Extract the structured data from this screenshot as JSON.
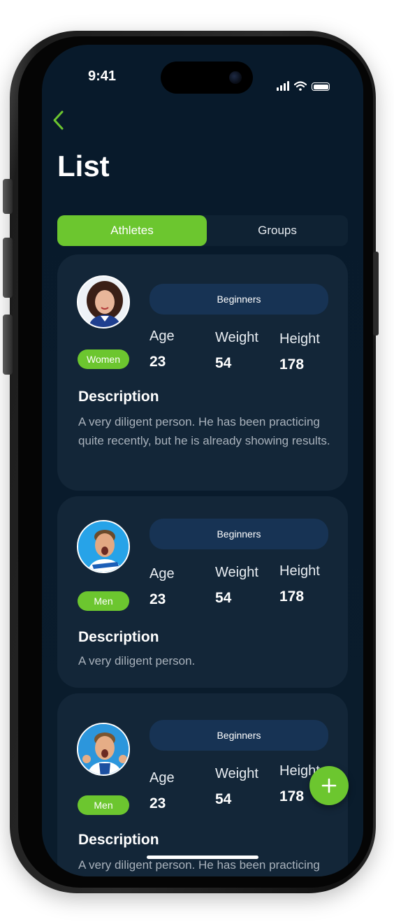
{
  "status_bar": {
    "time": "9:41"
  },
  "header": {
    "back_icon": "chevron-left-icon",
    "title": "List"
  },
  "tabs": [
    {
      "label": "Athletes",
      "selected": true
    },
    {
      "label": "Groups",
      "selected": false
    }
  ],
  "athletes": [
    {
      "group": "Beginners",
      "gender": "Women",
      "age_label": "Age",
      "age": "23",
      "weight_label": "Weight",
      "weight": "54",
      "height_label": "Height",
      "height": "178",
      "description_heading": "Description",
      "description": "A very diligent person. He has been practicing quite recently, but he is already showing results."
    },
    {
      "group": "Beginners",
      "gender": "Men",
      "age_label": "Age",
      "age": "23",
      "weight_label": "Weight",
      "weight": "54",
      "height_label": "Height",
      "height": "178",
      "description_heading": "Description",
      "description": "A very diligent person."
    },
    {
      "group": "Beginners",
      "gender": "Men",
      "age_label": "Age",
      "age": "23",
      "weight_label": "Weight",
      "weight": "54",
      "height_label": "Height",
      "height": "178",
      "description_heading": "Description",
      "description": "A very diligent person. He has been practicing"
    }
  ],
  "fab": {
    "icon": "plus-icon"
  },
  "colors": {
    "accent": "#6cc62f",
    "background": "#081a2b",
    "card": "#132638",
    "pill": "#173354"
  }
}
